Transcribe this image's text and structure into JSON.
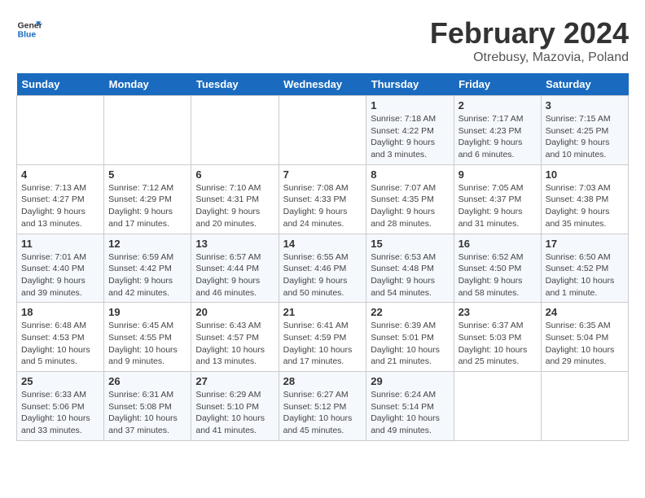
{
  "header": {
    "logo_line1": "General",
    "logo_line2": "Blue",
    "title": "February 2024",
    "subtitle": "Otrebusy, Mazovia, Poland"
  },
  "days_of_week": [
    "Sunday",
    "Monday",
    "Tuesday",
    "Wednesday",
    "Thursday",
    "Friday",
    "Saturday"
  ],
  "weeks": [
    [
      {
        "day": "",
        "detail": ""
      },
      {
        "day": "",
        "detail": ""
      },
      {
        "day": "",
        "detail": ""
      },
      {
        "day": "",
        "detail": ""
      },
      {
        "day": "1",
        "detail": "Sunrise: 7:18 AM\nSunset: 4:22 PM\nDaylight: 9 hours\nand 3 minutes."
      },
      {
        "day": "2",
        "detail": "Sunrise: 7:17 AM\nSunset: 4:23 PM\nDaylight: 9 hours\nand 6 minutes."
      },
      {
        "day": "3",
        "detail": "Sunrise: 7:15 AM\nSunset: 4:25 PM\nDaylight: 9 hours\nand 10 minutes."
      }
    ],
    [
      {
        "day": "4",
        "detail": "Sunrise: 7:13 AM\nSunset: 4:27 PM\nDaylight: 9 hours\nand 13 minutes."
      },
      {
        "day": "5",
        "detail": "Sunrise: 7:12 AM\nSunset: 4:29 PM\nDaylight: 9 hours\nand 17 minutes."
      },
      {
        "day": "6",
        "detail": "Sunrise: 7:10 AM\nSunset: 4:31 PM\nDaylight: 9 hours\nand 20 minutes."
      },
      {
        "day": "7",
        "detail": "Sunrise: 7:08 AM\nSunset: 4:33 PM\nDaylight: 9 hours\nand 24 minutes."
      },
      {
        "day": "8",
        "detail": "Sunrise: 7:07 AM\nSunset: 4:35 PM\nDaylight: 9 hours\nand 28 minutes."
      },
      {
        "day": "9",
        "detail": "Sunrise: 7:05 AM\nSunset: 4:37 PM\nDaylight: 9 hours\nand 31 minutes."
      },
      {
        "day": "10",
        "detail": "Sunrise: 7:03 AM\nSunset: 4:38 PM\nDaylight: 9 hours\nand 35 minutes."
      }
    ],
    [
      {
        "day": "11",
        "detail": "Sunrise: 7:01 AM\nSunset: 4:40 PM\nDaylight: 9 hours\nand 39 minutes."
      },
      {
        "day": "12",
        "detail": "Sunrise: 6:59 AM\nSunset: 4:42 PM\nDaylight: 9 hours\nand 42 minutes."
      },
      {
        "day": "13",
        "detail": "Sunrise: 6:57 AM\nSunset: 4:44 PM\nDaylight: 9 hours\nand 46 minutes."
      },
      {
        "day": "14",
        "detail": "Sunrise: 6:55 AM\nSunset: 4:46 PM\nDaylight: 9 hours\nand 50 minutes."
      },
      {
        "day": "15",
        "detail": "Sunrise: 6:53 AM\nSunset: 4:48 PM\nDaylight: 9 hours\nand 54 minutes."
      },
      {
        "day": "16",
        "detail": "Sunrise: 6:52 AM\nSunset: 4:50 PM\nDaylight: 9 hours\nand 58 minutes."
      },
      {
        "day": "17",
        "detail": "Sunrise: 6:50 AM\nSunset: 4:52 PM\nDaylight: 10 hours\nand 1 minute."
      }
    ],
    [
      {
        "day": "18",
        "detail": "Sunrise: 6:48 AM\nSunset: 4:53 PM\nDaylight: 10 hours\nand 5 minutes."
      },
      {
        "day": "19",
        "detail": "Sunrise: 6:45 AM\nSunset: 4:55 PM\nDaylight: 10 hours\nand 9 minutes."
      },
      {
        "day": "20",
        "detail": "Sunrise: 6:43 AM\nSunset: 4:57 PM\nDaylight: 10 hours\nand 13 minutes."
      },
      {
        "day": "21",
        "detail": "Sunrise: 6:41 AM\nSunset: 4:59 PM\nDaylight: 10 hours\nand 17 minutes."
      },
      {
        "day": "22",
        "detail": "Sunrise: 6:39 AM\nSunset: 5:01 PM\nDaylight: 10 hours\nand 21 minutes."
      },
      {
        "day": "23",
        "detail": "Sunrise: 6:37 AM\nSunset: 5:03 PM\nDaylight: 10 hours\nand 25 minutes."
      },
      {
        "day": "24",
        "detail": "Sunrise: 6:35 AM\nSunset: 5:04 PM\nDaylight: 10 hours\nand 29 minutes."
      }
    ],
    [
      {
        "day": "25",
        "detail": "Sunrise: 6:33 AM\nSunset: 5:06 PM\nDaylight: 10 hours\nand 33 minutes."
      },
      {
        "day": "26",
        "detail": "Sunrise: 6:31 AM\nSunset: 5:08 PM\nDaylight: 10 hours\nand 37 minutes."
      },
      {
        "day": "27",
        "detail": "Sunrise: 6:29 AM\nSunset: 5:10 PM\nDaylight: 10 hours\nand 41 minutes."
      },
      {
        "day": "28",
        "detail": "Sunrise: 6:27 AM\nSunset: 5:12 PM\nDaylight: 10 hours\nand 45 minutes."
      },
      {
        "day": "29",
        "detail": "Sunrise: 6:24 AM\nSunset: 5:14 PM\nDaylight: 10 hours\nand 49 minutes."
      },
      {
        "day": "",
        "detail": ""
      },
      {
        "day": "",
        "detail": ""
      }
    ]
  ]
}
